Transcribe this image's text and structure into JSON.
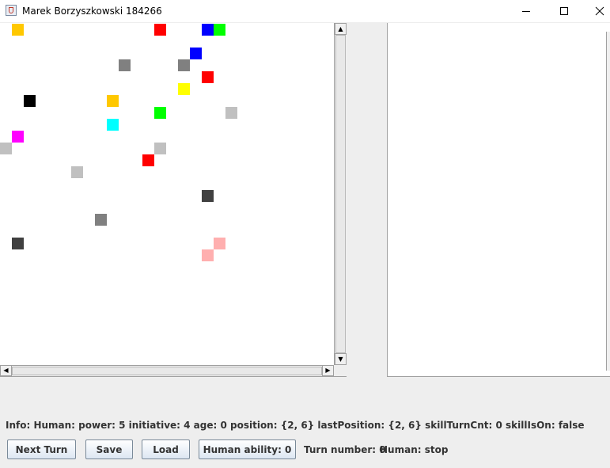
{
  "window": {
    "title": "Marek Borzyszkowski 184266",
    "minimize_icon": "minimize-icon",
    "maximize_icon": "maximize-icon",
    "close_icon": "close-icon"
  },
  "world": {
    "organisms": [
      {
        "col": 1,
        "row": 0,
        "color": "#ffc800"
      },
      {
        "col": 13,
        "row": 0,
        "color": "#ff0000"
      },
      {
        "col": 17,
        "row": 0,
        "color": "#0000ff"
      },
      {
        "col": 18,
        "row": 0,
        "color": "#00ff00"
      },
      {
        "col": 16,
        "row": 2,
        "color": "#0000ff"
      },
      {
        "col": 10,
        "row": 3,
        "color": "#808080"
      },
      {
        "col": 15,
        "row": 3,
        "color": "#808080"
      },
      {
        "col": 17,
        "row": 4,
        "color": "#ff0000"
      },
      {
        "col": 15,
        "row": 5,
        "color": "#ffff00"
      },
      {
        "col": 2,
        "row": 6,
        "color": "#000000"
      },
      {
        "col": 9,
        "row": 6,
        "color": "#ffc800"
      },
      {
        "col": 13,
        "row": 7,
        "color": "#00ff00"
      },
      {
        "col": 19,
        "row": 7,
        "color": "#c0c0c0"
      },
      {
        "col": 9,
        "row": 8,
        "color": "#00ffff"
      },
      {
        "col": 1,
        "row": 9,
        "color": "#ff00ff"
      },
      {
        "col": 0,
        "row": 10,
        "color": "#c0c0c0"
      },
      {
        "col": 13,
        "row": 10,
        "color": "#c0c0c0"
      },
      {
        "col": 12,
        "row": 11,
        "color": "#ff0000"
      },
      {
        "col": 6,
        "row": 12,
        "color": "#c0c0c0"
      },
      {
        "col": 17,
        "row": 14,
        "color": "#404040"
      },
      {
        "col": 8,
        "row": 16,
        "color": "#808080"
      },
      {
        "col": 1,
        "row": 18,
        "color": "#404040"
      },
      {
        "col": 18,
        "row": 18,
        "color": "#ffafaf"
      },
      {
        "col": 17,
        "row": 19,
        "color": "#ffafaf"
      }
    ]
  },
  "info": {
    "text": "Info: Human: power: 5 initiative: 4 age: 0 position: {2, 6} lastPosition: {2, 6} skillTurnCnt: 0 skillIsOn: false"
  },
  "controls": {
    "next_turn": "Next Turn",
    "save": "Save",
    "load": "Load",
    "human_ability": "Human ability: 0",
    "turn_number": "Turn number: 0",
    "human_status": "Human: stop"
  }
}
